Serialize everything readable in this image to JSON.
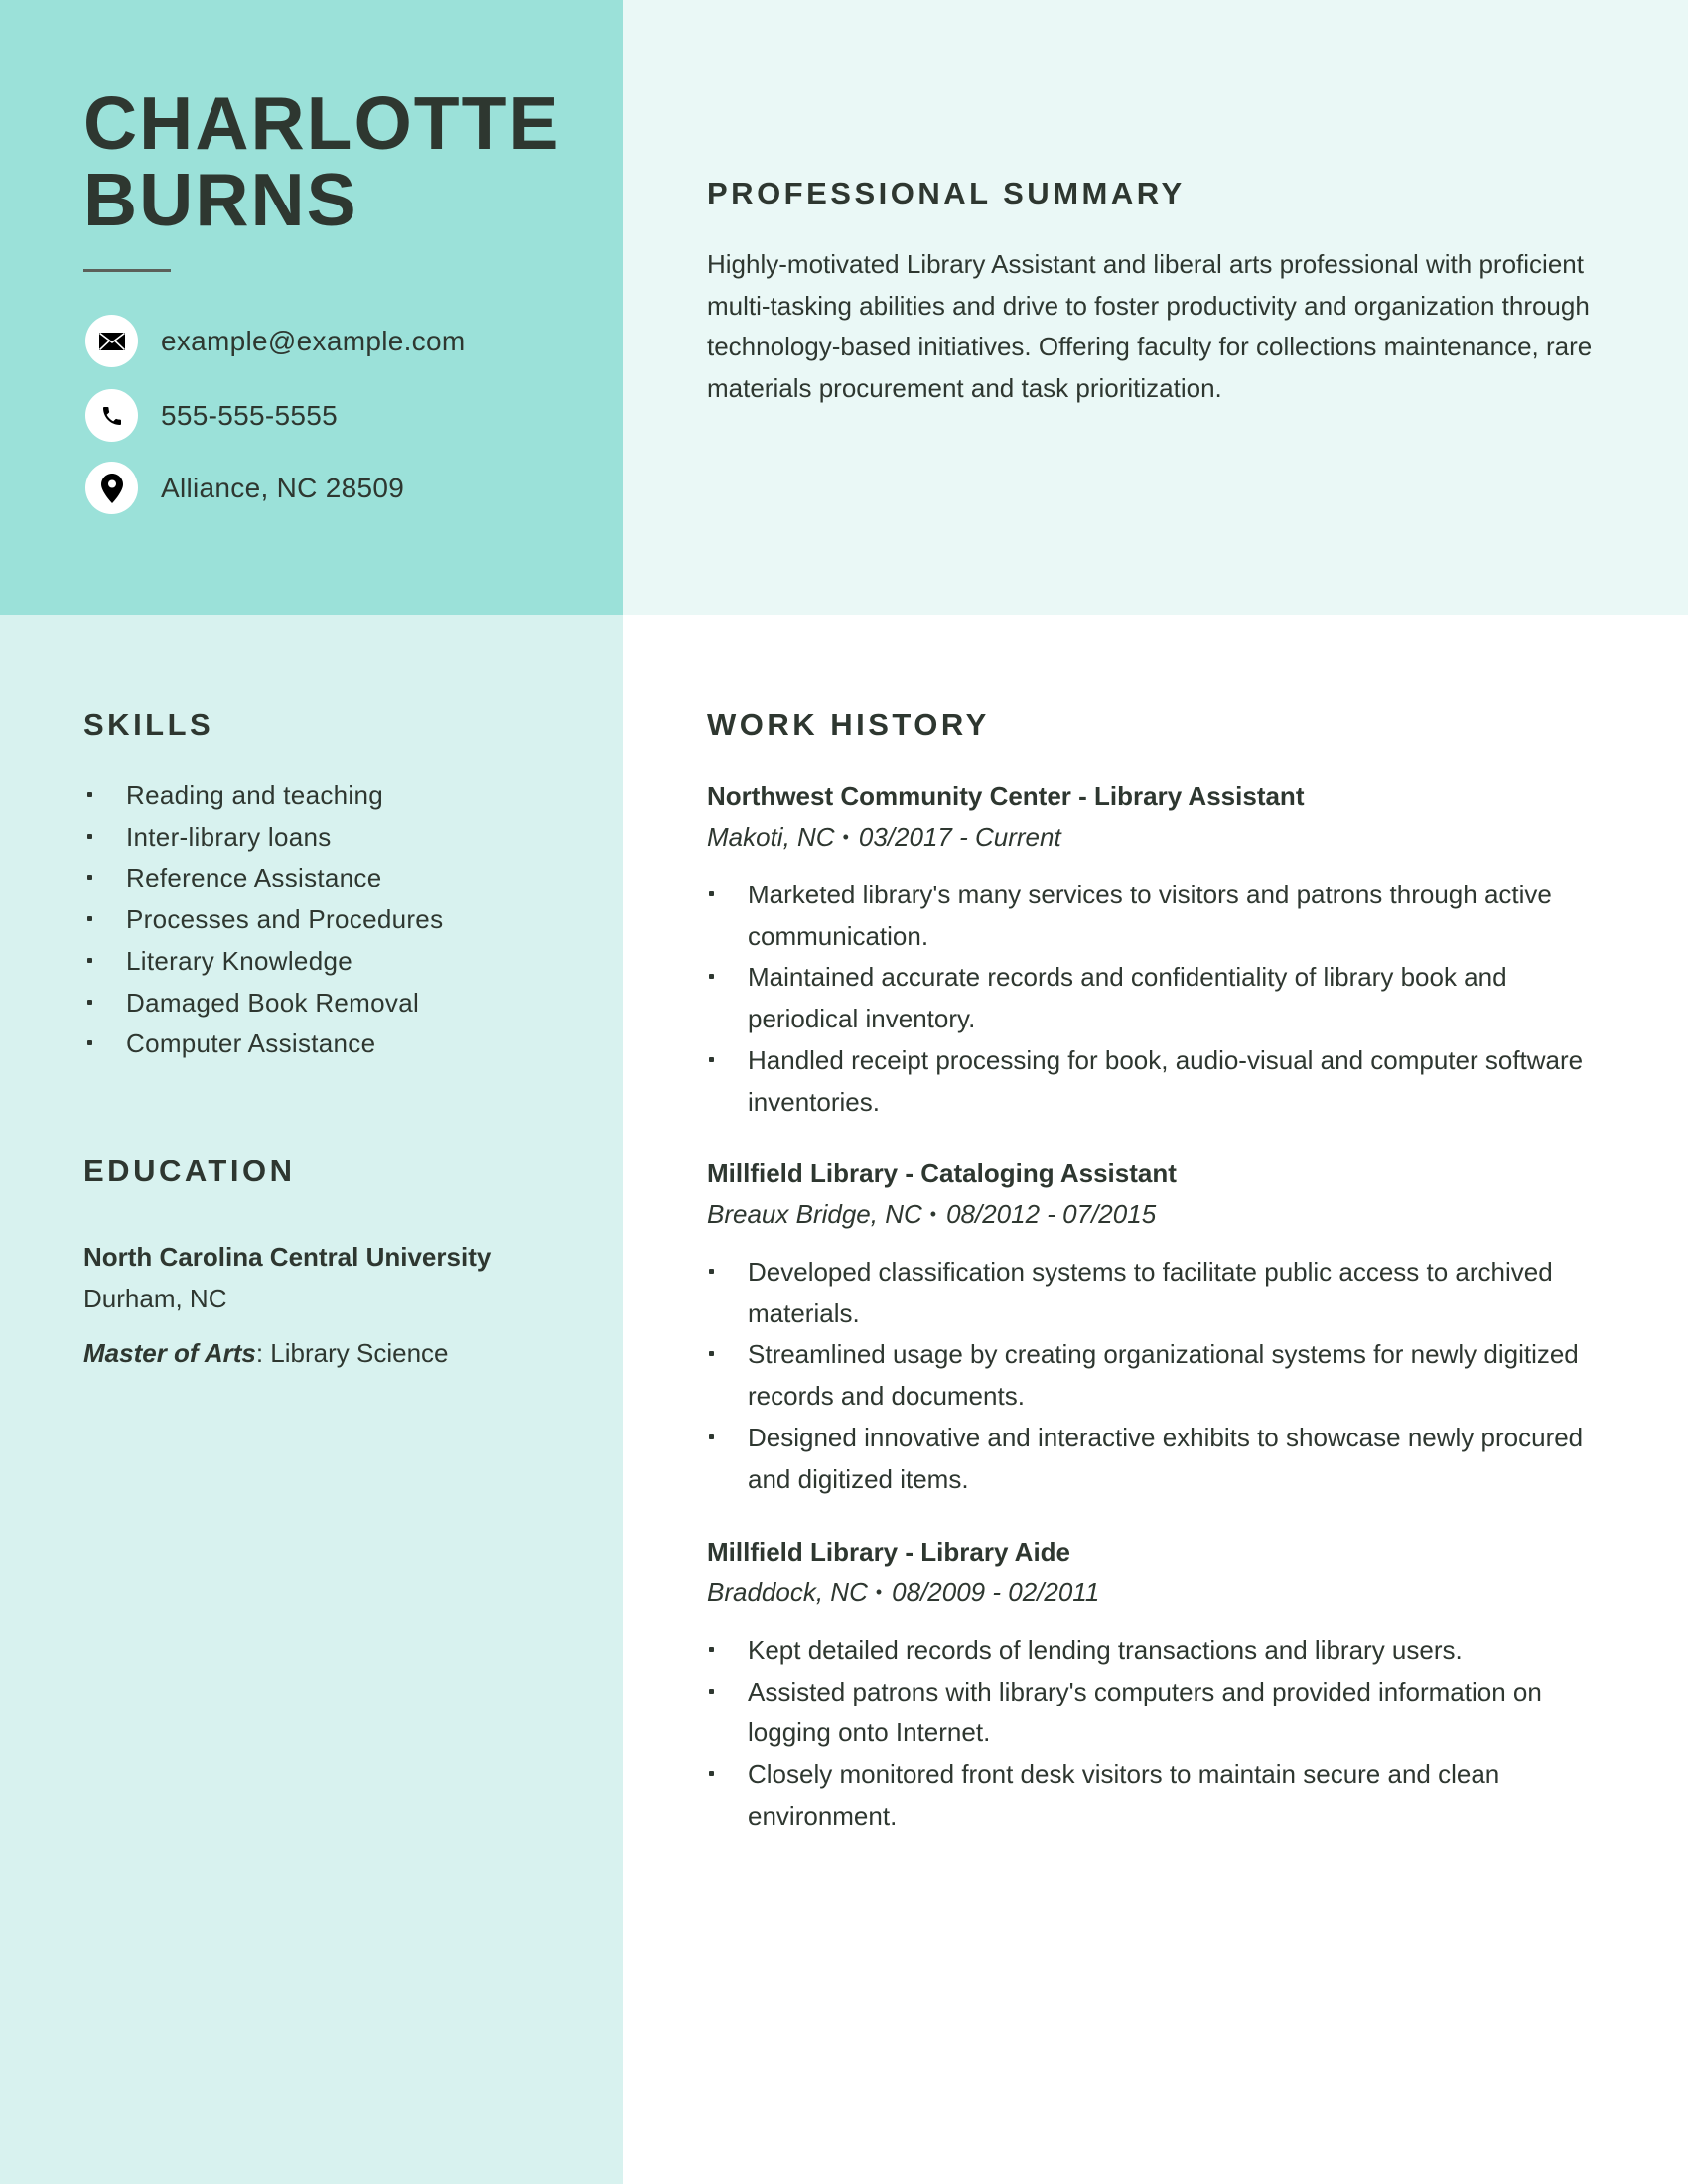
{
  "colors": {
    "header_left_bg": "#9be1d9",
    "header_right_bg": "#eaf8f6",
    "sidebar_bg": "#d8f2ef",
    "main_bg": "#ffffff",
    "text": "#2e3730"
  },
  "profile": {
    "first_name": "CHARLOTTE",
    "last_name": "BURNS"
  },
  "contact": [
    {
      "icon": "envelope-icon",
      "value": "example@example.com"
    },
    {
      "icon": "phone-icon",
      "value": "555-555-5555"
    },
    {
      "icon": "map-pin-icon",
      "value": "Alliance, NC 28509"
    }
  ],
  "summary": {
    "heading": "PROFESSIONAL SUMMARY",
    "text": "Highly-motivated Library Assistant and liberal arts professional with proficient multi-tasking abilities and drive to foster productivity and organization through technology-based initiatives. Offering faculty for collections maintenance, rare materials procurement and task prioritization."
  },
  "skills": {
    "heading": "SKILLS",
    "items": [
      "Reading and teaching",
      "Inter-library loans",
      "Reference Assistance",
      "Processes and Procedures",
      "Literary Knowledge",
      "Damaged Book Removal",
      "Computer Assistance"
    ]
  },
  "education": {
    "heading": "EDUCATION",
    "school": "North Carolina Central University",
    "location": "Durham, NC",
    "degree": "Master of Arts",
    "field": ": Library Science"
  },
  "work_history": {
    "heading": "WORK HISTORY",
    "jobs": [
      {
        "employer": "Northwest Community Center",
        "title": "Library Assistant",
        "location": "Makoti, NC",
        "dates": "03/2017 - Current",
        "bullets": [
          "Marketed library's many services to visitors and patrons through active communication.",
          "Maintained accurate records and confidentiality of library book and periodical inventory.",
          "Handled receipt processing for book, audio-visual and computer software inventories."
        ]
      },
      {
        "employer": "Millfield Library",
        "title": "Cataloging Assistant",
        "location": "Breaux Bridge, NC",
        "dates": "08/2012 - 07/2015",
        "bullets": [
          "Developed classification systems to facilitate public access to archived materials.",
          "Streamlined usage by creating organizational systems for newly digitized records and documents.",
          "Designed innovative and interactive exhibits to showcase newly procured and digitized items."
        ]
      },
      {
        "employer": "Millfield Library",
        "title": "Library Aide",
        "location": "Braddock, NC",
        "dates": "08/2009 - 02/2011",
        "bullets": [
          "Kept detailed records of lending transactions and library users.",
          "Assisted patrons with library's computers and provided information on logging onto Internet.",
          "Closely monitored front desk visitors to maintain secure and clean environment."
        ]
      }
    ],
    "title_separator": " - ",
    "meta_separator": "•"
  }
}
